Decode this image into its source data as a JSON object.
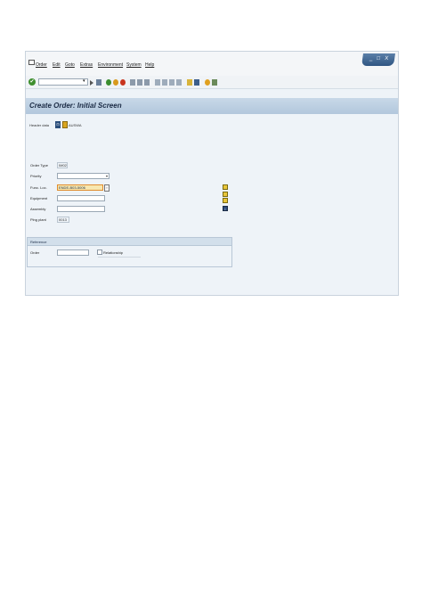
{
  "menu": {
    "items": [
      "Order",
      "Edit",
      "Goto",
      "Extras",
      "Environment",
      "System",
      "Help"
    ]
  },
  "window_controls": {
    "minimize": "_",
    "restore": "□",
    "close": "X"
  },
  "toolbar": {
    "command_field_value": "",
    "dropdown_glyph": "▾"
  },
  "screen": {
    "title": "Create Order: Initial Screen"
  },
  "app_toolbar": {
    "header_data_label": "Header data",
    "ausw_label": "AUSWA"
  },
  "form": {
    "order_type": {
      "label": "Order Type",
      "value": "IM02"
    },
    "priority": {
      "label": "Priority",
      "value": ""
    },
    "func_loc": {
      "label": "Func. Loc.",
      "value": "ENDE-B03-5006"
    },
    "equipment": {
      "label": "Equipment",
      "value": ""
    },
    "assembly": {
      "label": "Assembly",
      "value": ""
    },
    "plng_plant": {
      "label": "Plng plant",
      "value": "0013"
    }
  },
  "reference": {
    "title": "Reference",
    "order_label": "Order",
    "order_value": "",
    "relationship_label": "Relationship"
  },
  "colors": {
    "title_bar": "#b2c7dc",
    "focused_field": "#f7e7b0",
    "focus_border": "#e08c2c",
    "window_bg": "#eef3f8"
  }
}
